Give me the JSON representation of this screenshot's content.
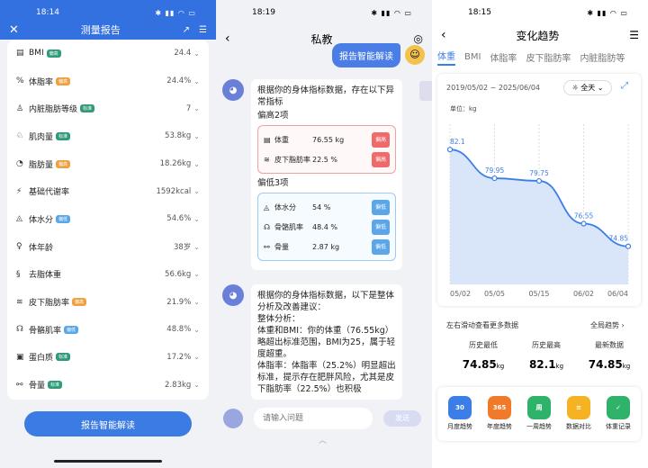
{
  "panel1": {
    "time": "18:14",
    "title": "测量报告",
    "metrics": [
      {
        "icon": "▤",
        "name": "BMI",
        "badge": "偏高",
        "badge_color": "#2f9b7a",
        "value": "24.4"
      },
      {
        "icon": "%",
        "name": "体脂率",
        "badge": "偏高",
        "badge_color": "#f0a040",
        "value": "24.4%"
      },
      {
        "icon": "♙",
        "name": "内脏脂肪等级",
        "badge": "标准",
        "badge_color": "#2f9b7a",
        "value": "7"
      },
      {
        "icon": "♘",
        "name": "肌肉量",
        "badge": "标准",
        "badge_color": "#2f9b7a",
        "value": "53.8kg"
      },
      {
        "icon": "◔",
        "name": "脂肪量",
        "badge": "偏高",
        "badge_color": "#f0a040",
        "value": "18.26kg"
      },
      {
        "icon": "⚡",
        "name": "基础代谢率",
        "badge": "",
        "badge_color": "",
        "value": "1592kcal"
      },
      {
        "icon": "◬",
        "name": "体水分",
        "badge": "偏低",
        "badge_color": "#5aa6e8",
        "value": "54.6%"
      },
      {
        "icon": "♀",
        "name": "体年龄",
        "badge": "",
        "badge_color": "",
        "value": "38岁"
      },
      {
        "icon": "§",
        "name": "去脂体重",
        "badge": "",
        "badge_color": "",
        "value": "56.6kg"
      },
      {
        "icon": "≋",
        "name": "皮下脂肪率",
        "badge": "偏高",
        "badge_color": "#f0a040",
        "value": "21.9%"
      },
      {
        "icon": "☊",
        "name": "骨骼肌率",
        "badge": "偏低",
        "badge_color": "#5aa6e8",
        "value": "48.8%"
      },
      {
        "icon": "▣",
        "name": "蛋白质",
        "badge": "标准",
        "badge_color": "#2f9b7a",
        "value": "17.2%"
      },
      {
        "icon": "⚯",
        "name": "骨量",
        "badge": "标准",
        "badge_color": "#2f9b7a",
        "value": "2.83kg"
      }
    ],
    "button": "报告智能解读"
  },
  "panel2": {
    "time": "18:19",
    "title": "私教",
    "user_msg": "报告智能解读",
    "reply1_intro": "根据你的身体指标数据，存在以下异常指标",
    "high_title": "偏高2项",
    "high_items": [
      {
        "icon": "▤",
        "name": "体重",
        "value": "76.55 kg",
        "tag": "偏高"
      },
      {
        "icon": "≋",
        "name": "皮下脂肪率",
        "value": "22.5 %",
        "tag": "偏高"
      }
    ],
    "low_title": "偏低3项",
    "low_items": [
      {
        "icon": "◬",
        "name": "体水分",
        "value": "54 %",
        "tag": "偏低"
      },
      {
        "icon": "☊",
        "name": "骨骼肌率",
        "value": "48.4 %",
        "tag": "偏低"
      },
      {
        "icon": "⚯",
        "name": "骨量",
        "value": "2.87 kg",
        "tag": "偏低"
      }
    ],
    "reply2": "根据你的身体指标数据，以下是整体分析及改善建议：\n整体分析：\n体重和BMI：你的体重（76.55kg）略超出标准范围，BMI为25，属于轻度超重。\n体脂率：体脂率（25.2%）明显超出标准，提示存在肥胖风险，尤其是皮下脂肪率（22.5%）也积极",
    "input_placeholder": "请输入问题",
    "send": "发送"
  },
  "panel3": {
    "time": "18:15",
    "title": "变化趋势",
    "tabs": [
      "体重",
      "BMI",
      "体脂率",
      "皮下脂肪率",
      "内脏脂肪等"
    ],
    "date_range": "2019/05/02 ~ 2025/06/04",
    "filter": "全天",
    "unit": "单位：kg",
    "hint": "左右滑动查看更多数据",
    "global_trend": "全局趋势",
    "stats": [
      {
        "label": "历史最低",
        "value": "74.85",
        "unit": "kg"
      },
      {
        "label": "历史最高",
        "value": "82.1",
        "unit": "kg"
      },
      {
        "label": "最新数据",
        "value": "74.85",
        "unit": "kg"
      }
    ],
    "quick": [
      {
        "label": "月度趋势",
        "glyph": "30",
        "color": "#3b7ee8"
      },
      {
        "label": "年度趋势",
        "glyph": "365",
        "color": "#f07a2a"
      },
      {
        "label": "一周趋势",
        "glyph": "周",
        "color": "#2fb36b"
      },
      {
        "label": "数据对比",
        "glyph": "≡",
        "color": "#f5b323"
      },
      {
        "label": "体重记录",
        "glyph": "✓",
        "color": "#2fb36b"
      }
    ]
  },
  "chart_data": {
    "type": "area",
    "categories": [
      "05/02",
      "05/05",
      "05/15",
      "06/02",
      "06/04"
    ],
    "values": [
      82.1,
      79.95,
      79.75,
      76.55,
      74.85
    ],
    "ylim": [
      72,
      84
    ],
    "color": "#3b7ee8"
  }
}
